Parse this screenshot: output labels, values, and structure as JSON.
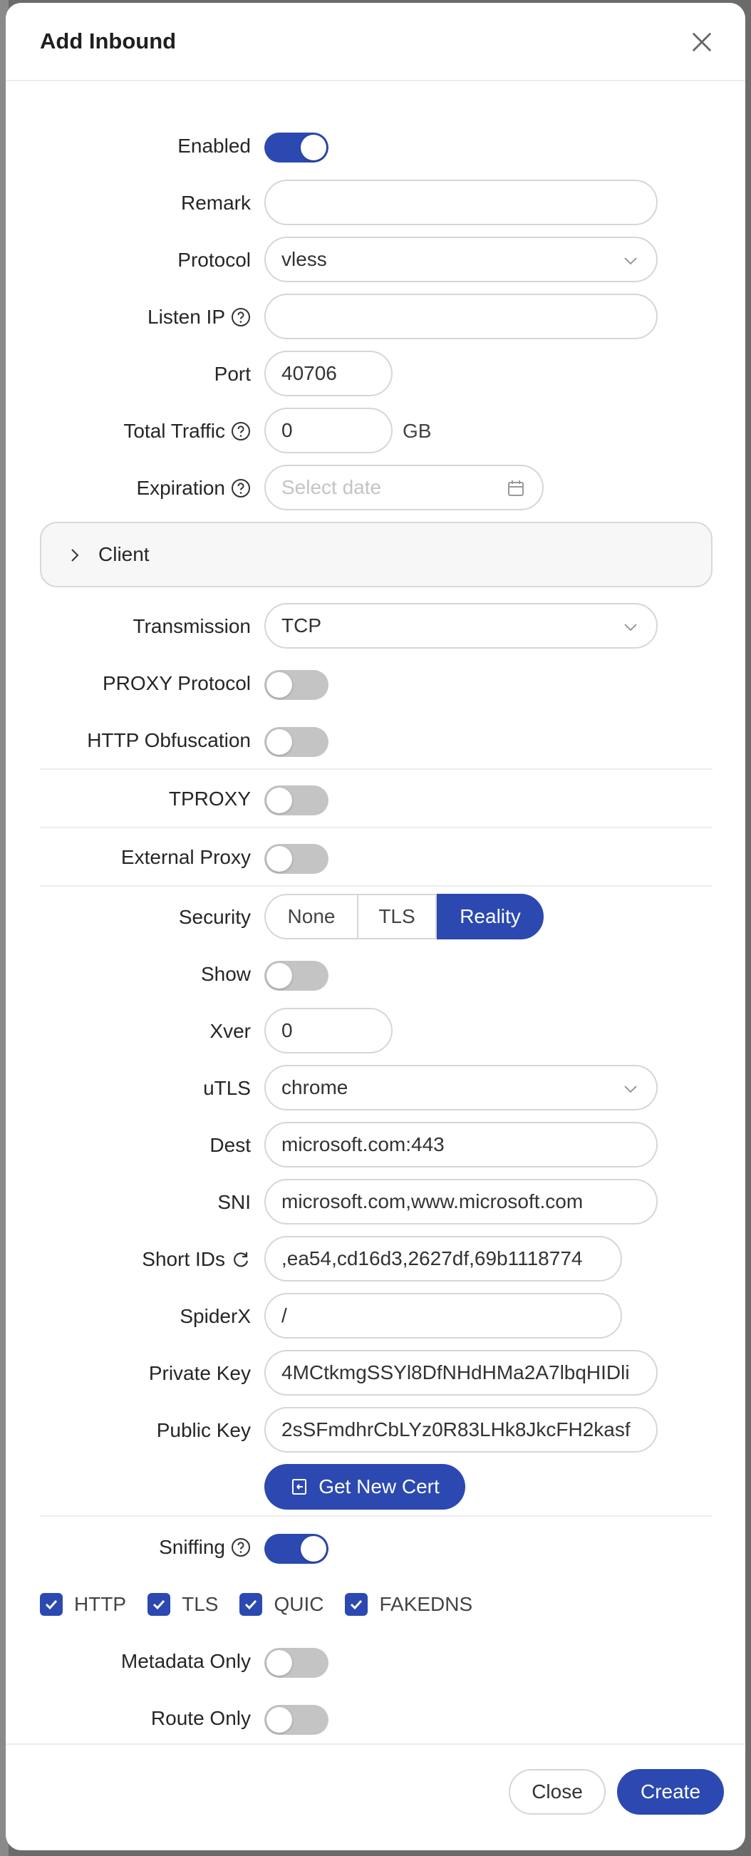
{
  "modal": {
    "title": "Add Inbound"
  },
  "fields": {
    "enabled": {
      "label": "Enabled",
      "on": true
    },
    "remark": {
      "label": "Remark",
      "value": ""
    },
    "protocol": {
      "label": "Protocol",
      "value": "vless"
    },
    "listen_ip": {
      "label": "Listen IP",
      "value": ""
    },
    "port": {
      "label": "Port",
      "value": "40706"
    },
    "total_traffic": {
      "label": "Total Traffic",
      "value": "0",
      "unit": "GB"
    },
    "expiration": {
      "label": "Expiration",
      "placeholder": "Select date"
    },
    "client": {
      "label": "Client"
    },
    "transmission": {
      "label": "Transmission",
      "value": "TCP"
    },
    "proxy_protocol": {
      "label": "PROXY Protocol",
      "on": false
    },
    "http_obfuscation": {
      "label": "HTTP Obfuscation",
      "on": false
    },
    "tproxy": {
      "label": "TPROXY",
      "on": false
    },
    "external_proxy": {
      "label": "External Proxy",
      "on": false
    },
    "security": {
      "label": "Security",
      "options": [
        "None",
        "TLS",
        "Reality"
      ],
      "selected": "Reality"
    },
    "show": {
      "label": "Show",
      "on": false
    },
    "xver": {
      "label": "Xver",
      "value": "0"
    },
    "utls": {
      "label": "uTLS",
      "value": "chrome"
    },
    "dest": {
      "label": "Dest",
      "value": "microsoft.com:443"
    },
    "sni": {
      "label": "SNI",
      "value": "microsoft.com,www.microsoft.com"
    },
    "short_ids": {
      "label": "Short IDs",
      "value": ",ea54,cd16d3,2627df,69b1118774"
    },
    "spiderx": {
      "label": "SpiderX",
      "value": "/"
    },
    "private_key": {
      "label": "Private Key",
      "value": "4MCtkmgSSYl8DfNHdHMa2A7lbqHIDli"
    },
    "public_key": {
      "label": "Public Key",
      "value": "2sSFmdhrCbLYz0R83LHk8JkcFH2kasf"
    },
    "get_new_cert": {
      "label": "Get New Cert"
    },
    "sniffing": {
      "label": "Sniffing",
      "on": true
    },
    "sniff_options": [
      "HTTP",
      "TLS",
      "QUIC",
      "FAKEDNS"
    ],
    "metadata_only": {
      "label": "Metadata Only",
      "on": false
    },
    "route_only": {
      "label": "Route Only",
      "on": false
    }
  },
  "footer": {
    "close_label": "Close",
    "create_label": "Create"
  },
  "colors": {
    "primary": "#2b49b0",
    "switch_off": "#c4c4c4",
    "border": "#d6d6d6"
  }
}
